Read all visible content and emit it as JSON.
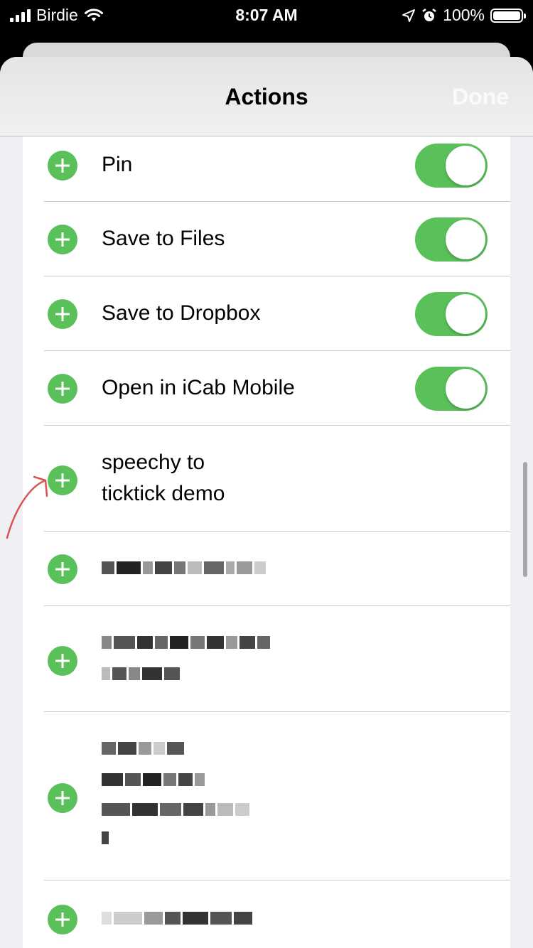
{
  "status_bar": {
    "carrier": "Birdie",
    "time": "8:07 AM",
    "battery": "100%",
    "battery_level": 1.0,
    "icons": [
      "signal-icon",
      "wifi-icon",
      "location-icon",
      "alarm-icon",
      "battery-icon"
    ]
  },
  "navbar": {
    "title": "Actions",
    "done_label": "Done"
  },
  "actions": [
    {
      "label": "Pin",
      "toggle_on": true
    },
    {
      "label": "Save to Files",
      "toggle_on": true
    },
    {
      "label": "Save to Dropbox",
      "toggle_on": true
    },
    {
      "label": "Open in iCab Mobile",
      "toggle_on": true
    },
    {
      "label_line1": "speechy to",
      "label_line2": "ticktick demo"
    }
  ],
  "colors": {
    "accent_green": "#5ac15a",
    "annotation_red": "#d9534f"
  }
}
